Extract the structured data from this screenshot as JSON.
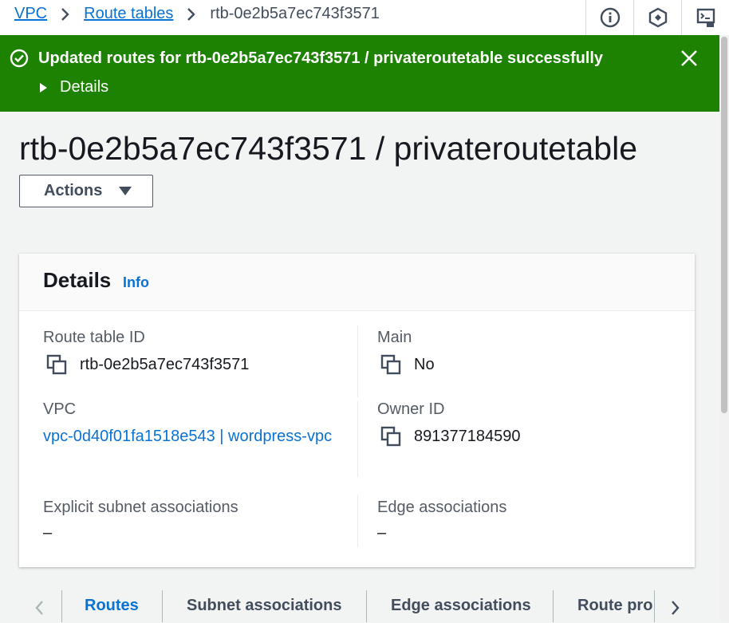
{
  "breadcrumb": {
    "items": [
      "VPC",
      "Route tables"
    ],
    "current": "rtb-0e2b5a7ec743f3571"
  },
  "top_icons": [
    "info-icon",
    "settings-hex-icon",
    "cloudshell-icon"
  ],
  "flash": {
    "message": "Updated routes for rtb-0e2b5a7ec743f3571 / privateroutetable successfully",
    "details_label": "Details",
    "color": "#1d8102"
  },
  "page": {
    "title": "rtb-0e2b5a7ec743f3571 / privateroutetable",
    "actions_label": "Actions"
  },
  "details": {
    "title": "Details",
    "info_label": "Info",
    "fields": {
      "route_table_id": {
        "label": "Route table ID",
        "value": "rtb-0e2b5a7ec743f3571"
      },
      "main": {
        "label": "Main",
        "value": "No"
      },
      "vpc": {
        "label": "VPC",
        "value": "vpc-0d40f01fa1518e543 | wordpress-vpc"
      },
      "owner_id": {
        "label": "Owner ID",
        "value": "891377184590"
      },
      "explicit_subnet_associations": {
        "label": "Explicit subnet associations",
        "value": "–"
      },
      "edge_associations": {
        "label": "Edge associations",
        "value": "–"
      }
    }
  },
  "tabs": [
    "Routes",
    "Subnet associations",
    "Edge associations",
    "Route pro"
  ],
  "active_tab": "Routes",
  "colors": {
    "link": "#0972d3",
    "success": "#1d8102"
  }
}
